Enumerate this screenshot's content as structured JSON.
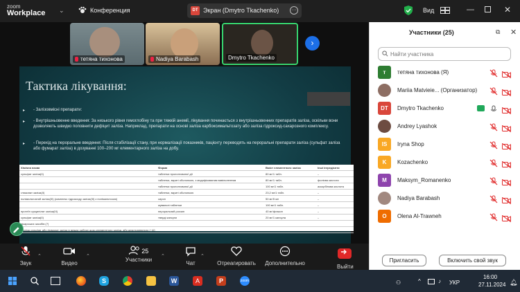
{
  "titlebar": {
    "brand_top": "zoom",
    "brand_bottom": "Workplace",
    "conference_label": "Конференция",
    "share_badge": "DT",
    "share_label": "Экран (Dmytro Tkachenko)",
    "view_label": "Вид",
    "icons": [
      "chevron-down-icon",
      "shield-check-icon",
      "view-grid-icon",
      "minimize-icon",
      "maximize-icon",
      "close-icon"
    ]
  },
  "thumbnails": [
    {
      "name": "тетяна тихонова",
      "muted": true
    },
    {
      "name": "Nadiya Barabash",
      "muted": true
    },
    {
      "name": "Dmytro Tkachenko",
      "muted": false
    }
  ],
  "slide": {
    "title": "Тактика лікування:",
    "bullets": [
      "- Залізовмісні препарати:",
      "- Внутрішньовенне введення: За низького рівня гемоглобіну та при тяжкій анемії, лікування починається з внутрішньовенних препаратів заліза, оскільки вони дозволяють швидко поповнити дефіцит заліза. Наприклад, препарати на основі заліза карбоксимальтозату або заліза гідроксид-сахарозного комплексу.",
      "- Перехід на пероральне введення: Після стабілізації стану, при нормалізації показників, пацієнту переводять на пероральні препарати заліза (сульфат заліза або фумарат заліза) в дозуванні 100–200 мг елементарного заліза на добу."
    ],
    "table": {
      "headers": [
        "Хімічна назва",
        "Форма",
        "Вміст елементного заліза",
        "Інші інгредієнти"
      ],
      "rows": [
        [
          "сульфат заліза(II)",
          "таблетки пролонгованої дії",
          "80 мг/1 табл.",
          "–"
        ],
        [
          "",
          "таблетки, вкриті оболонкою, з модифікованим вивільненням",
          "80 мг/1 табл.",
          "фолієва кислота"
        ],
        [
          "",
          "таблетки пролонгованої дії",
          "100 мг/1 табл.",
          "аскорбінова кислота"
        ],
        [
          "глюконат заліза(II)",
          "таблетки, вкриті оболонкою",
          "23,2 мг/1 табл.",
          "–"
        ],
        [
          "полімальтозний заліза(III) (комплекс гідроксиду заліза(III) з полімальтозою)",
          "сироп",
          "50 мг/5 мл",
          "–"
        ],
        [
          "",
          "жувальні таблетки",
          "100 мг/1 табл.",
          "–"
        ],
        [
          "протеїн сукцинілат заліза(III)",
          "пероральний розчин",
          "40 мг/флакон",
          "–"
        ],
        [
          "сульфат заліза(II)",
          "тверді капсули",
          "20 мг/1 капсула",
          "–"
        ],
        [
          "лікарських засобів (?)",
          "",
          "",
          ""
        ],
        [
          "*заліза сульфат або фумарат заліза в межах рибних дозо-елементного заліза, або декстраннрного (~40 мг)",
          "",
          "",
          ""
        ]
      ]
    }
  },
  "participants": {
    "title": "Участники (25)",
    "search_placeholder": "Найти участника",
    "list": [
      {
        "initial": "т",
        "name": "тетяна тихонова (Я)",
        "color": "#2e7d32",
        "photo": false,
        "mic": "muted",
        "cam": "off"
      },
      {
        "initial": "",
        "name": "Mariia Matvieie... (Организатор)",
        "color": "#8d6e63",
        "photo": true,
        "mic": "muted",
        "cam": "off"
      },
      {
        "initial": "DT",
        "name": "Dmytro Tkachenko",
        "color": "#d9463b",
        "photo": false,
        "mic": "on",
        "cam": "off",
        "sharing": true
      },
      {
        "initial": "",
        "name": "Andrey Lyashok",
        "color": "#6d4c41",
        "photo": true,
        "mic": "muted",
        "cam": "off"
      },
      {
        "initial": "IS",
        "name": "Iryna Shop",
        "color": "#f9a825",
        "photo": false,
        "mic": "muted",
        "cam": "off"
      },
      {
        "initial": "K",
        "name": "Kozachenko",
        "color": "#f9a825",
        "photo": false,
        "mic": "muted",
        "cam": "off"
      },
      {
        "initial": "M",
        "name": "Maksym_Romanenko",
        "color": "#8e44ad",
        "photo": false,
        "mic": "muted",
        "cam": "off"
      },
      {
        "initial": "",
        "name": "Nadiya Barabash",
        "color": "#a1887f",
        "photo": true,
        "mic": "muted",
        "cam": "off"
      },
      {
        "initial": "O",
        "name": "Olena Al-Trawneh",
        "color": "#ef6c00",
        "photo": false,
        "mic": "muted",
        "cam": "off"
      }
    ],
    "invite_label": "Пригласить",
    "unmute_label": "Включить свой звук"
  },
  "toolbar": {
    "audio": "Звук",
    "video": "Видео",
    "participants": "Участники",
    "participants_count": "25",
    "chat": "Чат",
    "react": "Отреагировать",
    "more": "Дополнительно",
    "leave": "Выйти"
  },
  "taskbar": {
    "time": "16:00",
    "date": "27.11.2024",
    "lang": "УКР",
    "apps": [
      "windows-start-icon",
      "search-icon",
      "firefox-icon",
      "skype-icon",
      "chrome-icon",
      "file-explorer-icon",
      "word-icon",
      "acrobat-icon",
      "powerpoint-icon",
      "zoom-icon"
    ]
  }
}
